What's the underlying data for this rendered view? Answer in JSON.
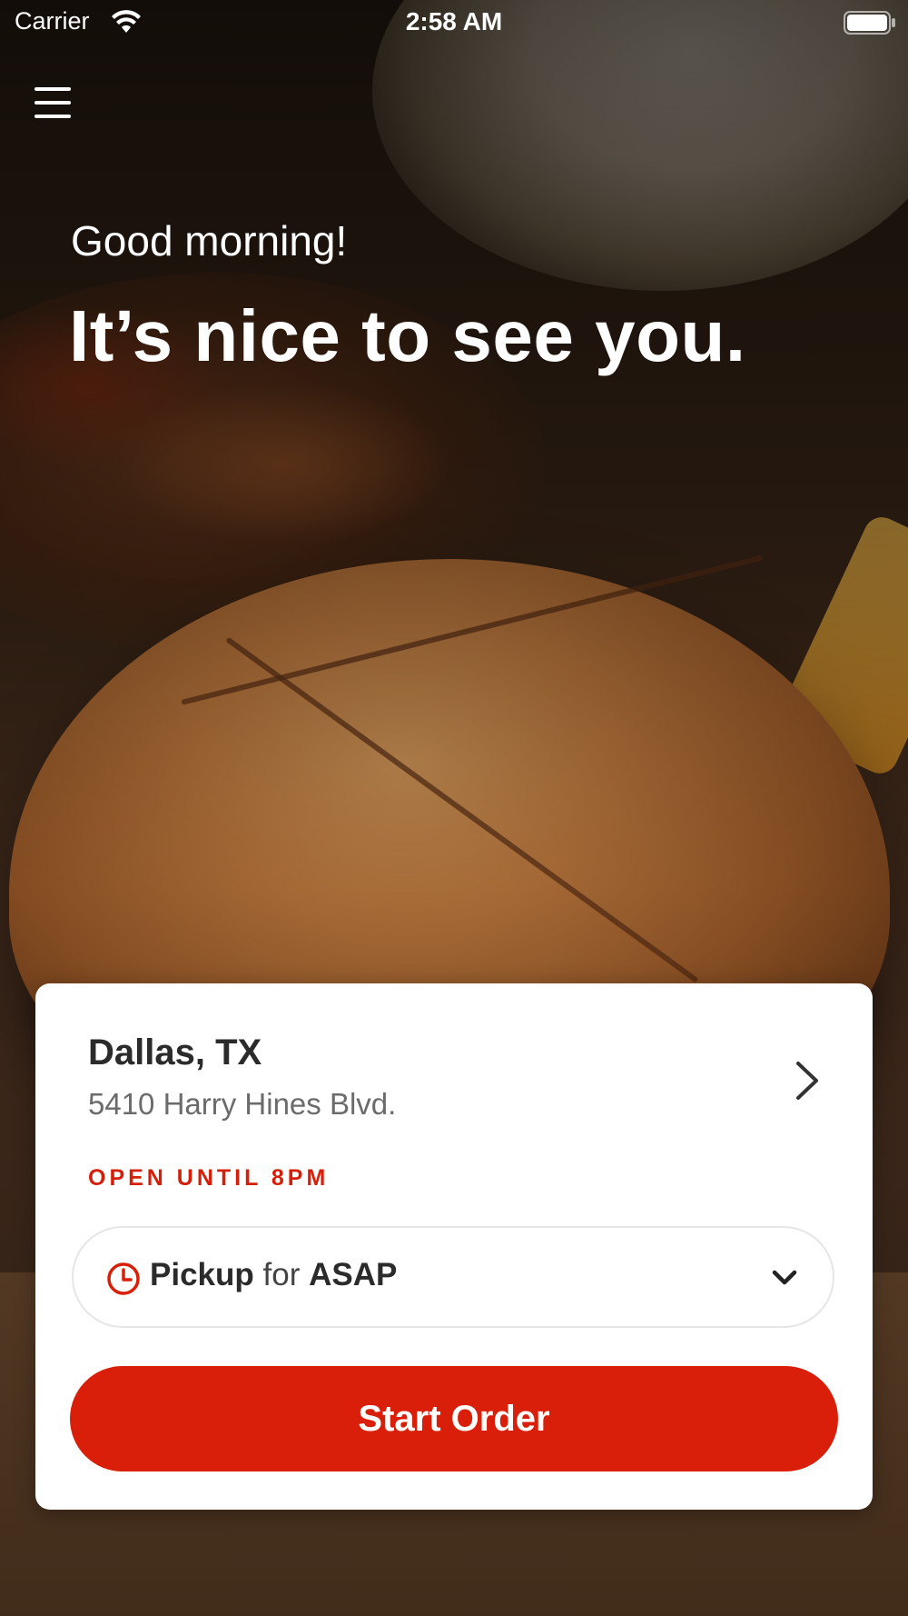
{
  "status_bar": {
    "carrier": "Carrier",
    "time": "2:58 AM"
  },
  "icons": {
    "menu": "hamburger-menu-icon",
    "wifi": "wifi-icon",
    "battery": "battery-icon",
    "chevron_right": "chevron-right-icon",
    "clock": "clock-icon",
    "chevron_down": "chevron-down-icon"
  },
  "hero": {
    "greeting": "Good morning!",
    "headline": "It’s nice to see you."
  },
  "location": {
    "city": "Dallas, TX",
    "address": "5410 Harry Hines Blvd.",
    "hours": "OPEN UNTIL 8PM"
  },
  "order_mode": {
    "mode": "Pickup",
    "connector": "for",
    "time": "ASAP"
  },
  "actions": {
    "start_order": "Start Order"
  },
  "colors": {
    "accent": "#d91f0a",
    "hours_text": "#d61f0a",
    "card_background": "#ffffff"
  }
}
